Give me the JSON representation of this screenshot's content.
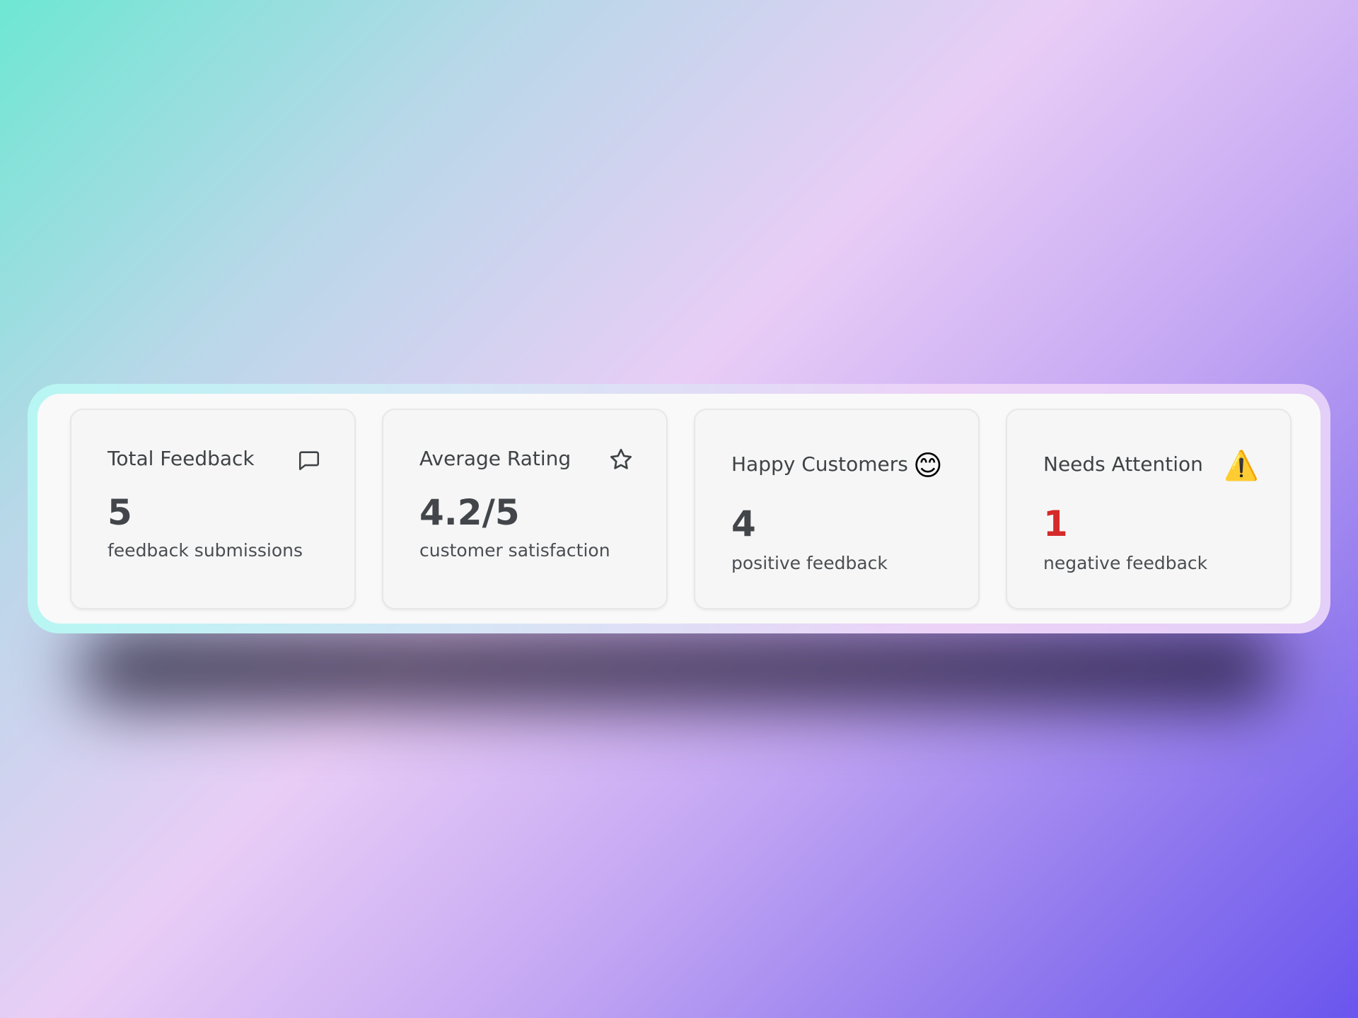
{
  "stats": [
    {
      "title": "Total Feedback",
      "value": "5",
      "subtitle": "feedback submissions",
      "icon": "message-square-icon"
    },
    {
      "title": "Average Rating",
      "value": "4.2/5",
      "subtitle": "customer satisfaction",
      "icon": "star-icon"
    },
    {
      "title": "Happy Customers",
      "value": "4",
      "subtitle": "positive feedback",
      "icon": "smiling-face-emoji",
      "glyph": "😊"
    },
    {
      "title": "Needs Attention",
      "value": "1",
      "subtitle": "negative feedback",
      "icon": "warning-emoji",
      "glyph": "⚠️"
    }
  ],
  "colors": {
    "value_default": "#42464a",
    "value_alert": "#d42a2a",
    "card_background": "#f6f6f6"
  }
}
